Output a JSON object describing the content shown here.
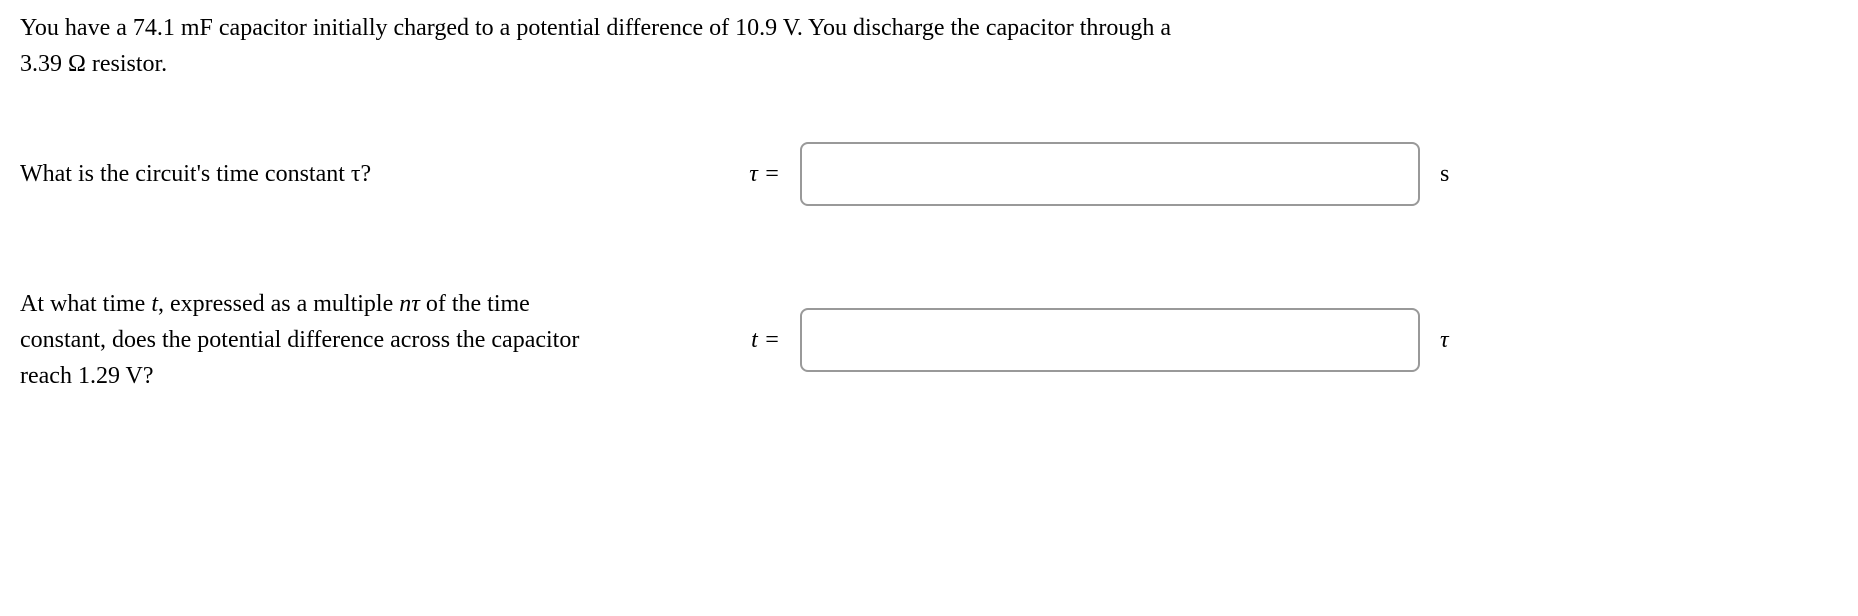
{
  "problem": {
    "line1": "You have a 74.1 mF capacitor initially charged to a potential difference of 10.9 V. You discharge the capacitor through a",
    "line2": "3.39 Ω resistor."
  },
  "question1": {
    "text": "What is the circuit's time constant τ?",
    "label": "τ =",
    "unit": "s"
  },
  "question2": {
    "text_line1": "At what time t, expressed as a multiple nτ of the time",
    "text_line2": "constant, does the potential difference across the capacitor",
    "text_line3": "reach 1.29 V?",
    "label_var": "t",
    "label_eq": " =",
    "unit": "τ"
  }
}
